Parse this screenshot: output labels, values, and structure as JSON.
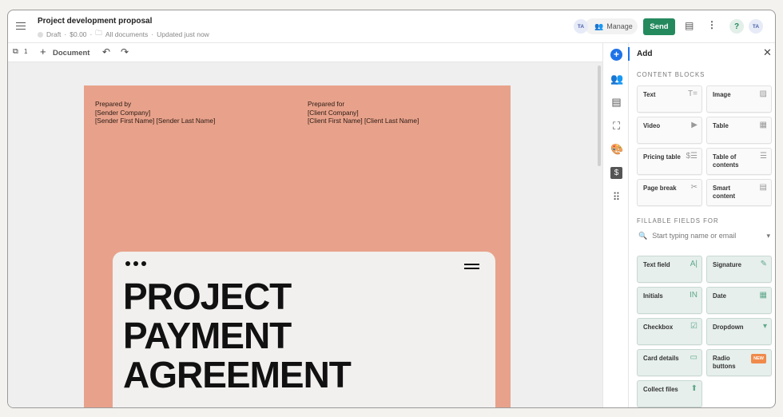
{
  "header": {
    "title": "Project development proposal",
    "status": "Draft",
    "amount": "$0.00",
    "folder": "All documents",
    "updated": "Updated just now",
    "avatar": "TA",
    "manage": "Manage",
    "send": "Send",
    "help": "?"
  },
  "toolbar": {
    "page_count": "1",
    "add_document": "Document"
  },
  "document": {
    "prepared_by": [
      "Prepared by",
      "[Sender Company]",
      "[Sender First Name] [Sender Last Name]"
    ],
    "prepared_for": [
      "Prepared for",
      "[Client Company]",
      "[Client First Name] [Client Last Name]"
    ],
    "headline": [
      "PROJECT",
      "PAYMENT",
      "AGREEMENT"
    ]
  },
  "panel": {
    "title": "Add",
    "content_blocks_label": "CONTENT BLOCKS",
    "content_blocks": [
      {
        "label": "Text",
        "icon": "T="
      },
      {
        "label": "Image",
        "icon": "▨"
      },
      {
        "label": "Video",
        "icon": "▶"
      },
      {
        "label": "Table",
        "icon": "▦"
      },
      {
        "label": "Pricing table",
        "icon": "$☰"
      },
      {
        "label": "Table of contents",
        "icon": "☰"
      },
      {
        "label": "Page break",
        "icon": "✂"
      },
      {
        "label": "Smart content",
        "icon": "▤"
      }
    ],
    "fillable_label": "FILLABLE FIELDS FOR",
    "search_placeholder": "Start typing name or email",
    "fields": [
      {
        "label": "Text field",
        "icon": "A|"
      },
      {
        "label": "Signature",
        "icon": "✎"
      },
      {
        "label": "Initials",
        "icon": "IN"
      },
      {
        "label": "Date",
        "icon": "▦"
      },
      {
        "label": "Checkbox",
        "icon": "☑"
      },
      {
        "label": "Dropdown",
        "icon": "▾"
      },
      {
        "label": "Card details",
        "icon": "▭"
      },
      {
        "label": "Radio buttons",
        "badge": "NEW"
      },
      {
        "label": "Collect files",
        "icon": "⬆"
      }
    ]
  },
  "colors": {
    "accent": "#248a5e",
    "page": "#e8a28b",
    "blue": "#1f73e8"
  }
}
